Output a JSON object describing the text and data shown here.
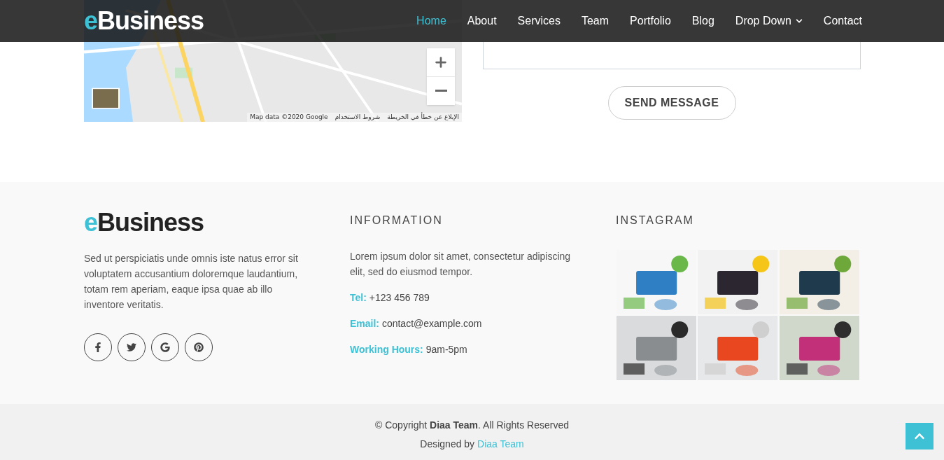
{
  "header": {
    "logo": {
      "accent": "e",
      "rest": "Business"
    },
    "nav": [
      {
        "label": "Home",
        "selected": true,
        "dropdown": false
      },
      {
        "label": "About",
        "selected": false,
        "dropdown": false
      },
      {
        "label": "Services",
        "selected": false,
        "dropdown": false
      },
      {
        "label": "Team",
        "selected": false,
        "dropdown": false
      },
      {
        "label": "Portfolio",
        "selected": false,
        "dropdown": false
      },
      {
        "label": "Blog",
        "selected": false,
        "dropdown": false
      },
      {
        "label": "Drop Down",
        "selected": false,
        "dropdown": true
      },
      {
        "label": "Contact",
        "selected": false,
        "dropdown": false
      }
    ]
  },
  "map": {
    "attribution": [
      "الإبلاغ عن خطأ في الخريطة",
      "شروط الاستخدام",
      "Map data ©2020 Google"
    ]
  },
  "contact_form": {
    "send_button": "SEND MESSAGE"
  },
  "footer": {
    "about": {
      "logo": {
        "accent": "e",
        "rest": "Business"
      },
      "text": "Sed ut perspiciatis unde omnis iste natus error sit voluptatem accusantium doloremque laudantium, totam rem aperiam, eaque ipsa quae ab illo inventore veritatis.",
      "social": [
        {
          "kind": "facebook"
        },
        {
          "kind": "twitter"
        },
        {
          "kind": "google"
        },
        {
          "kind": "pinterest"
        }
      ]
    },
    "information": {
      "title": "INFORMATION",
      "text": "Lorem ipsum dolor sit amet, consectetur adipiscing elit, sed do eiusmod tempor.",
      "details": [
        {
          "label": "Tel:",
          "value": "+123 456 789"
        },
        {
          "label": "Email:",
          "value": "contact@example.com"
        },
        {
          "label": "Working Hours:",
          "value": "9am-5pm"
        }
      ]
    },
    "instagram": {
      "title": "INSTAGRAM"
    }
  },
  "bottom_bar": {
    "copyright": "© Copyright **Diaa Team**. All Rights Reserved",
    "designed_by": "Designed by",
    "designer_link": "Diaa Team"
  }
}
